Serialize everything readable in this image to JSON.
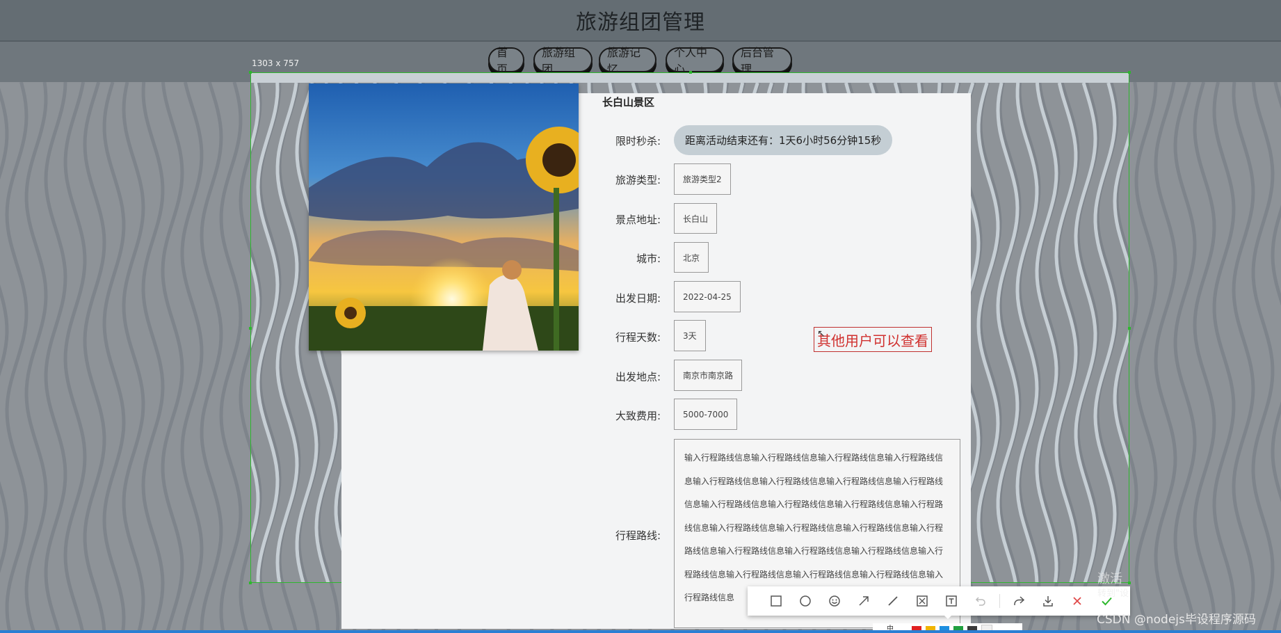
{
  "header": {
    "title": "旅游组团管理"
  },
  "nav": {
    "items": [
      {
        "label": "首页"
      },
      {
        "label": "旅游组团"
      },
      {
        "label": "旅游记忆"
      },
      {
        "label": "个人中心"
      },
      {
        "label": "后台管理"
      }
    ]
  },
  "capture": {
    "size_label": "1303 x 757"
  },
  "detail": {
    "title": "长白山景区",
    "countdown_label": "限时秒杀:",
    "countdown_text": "距离活动结束还有：1天6小时56分钟15秒",
    "fields": [
      {
        "label": "旅游类型:",
        "value": "旅游类型2"
      },
      {
        "label": "景点地址:",
        "value": "长白山"
      },
      {
        "label": "城市:",
        "value": "北京"
      },
      {
        "label": "出发日期:",
        "value": "2022-04-25"
      },
      {
        "label": "行程天数:",
        "value": "3天"
      },
      {
        "label": "出发地点:",
        "value": "南京市南京路"
      },
      {
        "label": "大致费用:",
        "value": "5000-7000"
      }
    ],
    "route_label": "行程路线:",
    "route_text": "输入行程路线信息输入行程路线信息输入行程路线信息输入行程路线信息输入行程路线信息输入行程路线信息输入行程路线信息输入行程路线信息输入行程路线信息输入行程路线信息输入行程路线信息输入行程路线信息输入行程路线信息输入行程路线信息输入行程路线信息输入行程路线信息输入行程路线信息输入行程路线信息输入行程路线信息输入行程路线信息输入行程路线信息输入行程路线信息输入行程路线信息输入行程路线信息"
  },
  "annotation": {
    "text": "其他用户可以查看"
  },
  "toolbar": {
    "tools": [
      "rectangle-icon",
      "ellipse-icon",
      "emoji-icon",
      "arrow-icon",
      "line-icon",
      "mosaic-icon",
      "text-icon",
      "undo-icon",
      "share-icon",
      "download-icon",
      "cancel-icon",
      "confirm-icon"
    ],
    "size_text": "中",
    "colors": [
      "#e02020",
      "#f0b400",
      "#1e8fe0",
      "#20a040",
      "#3a3a3a",
      "#f0f0f0"
    ]
  },
  "overlay": {
    "activate_title": "激活",
    "activate_sub": "转到\"设",
    "watermark": "CSDN @nodejs毕设程序源码"
  }
}
